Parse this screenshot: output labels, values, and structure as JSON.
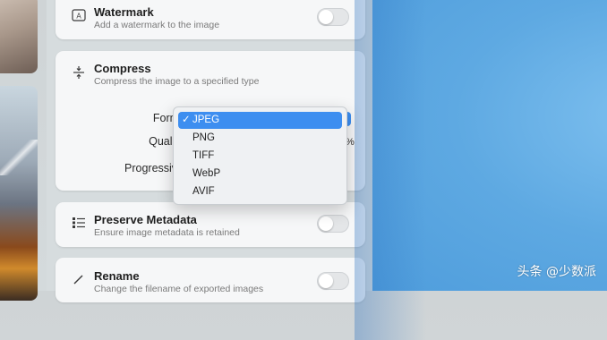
{
  "cards": {
    "watermark": {
      "title": "Watermark",
      "subtitle": "Add a watermark to the image",
      "enabled": false
    },
    "compress": {
      "title": "Compress",
      "subtitle": "Compress the image to a specified type",
      "fields": {
        "format_label": "Forma",
        "quality_label": "Quality",
        "progressive_label": "Progressive"
      },
      "quality_peek": "%"
    },
    "preserve_metadata": {
      "title": "Preserve Metadata",
      "subtitle": "Ensure image metadata is retained",
      "enabled": false
    },
    "rename": {
      "title": "Rename",
      "subtitle": "Change the filename of exported images",
      "enabled": false
    }
  },
  "format_dropdown": {
    "check": "✓",
    "options": [
      "JPEG",
      "PNG",
      "TIFF",
      "WebP",
      "AVIF"
    ],
    "selected": "JPEG"
  },
  "watermark_overlay": "头条 @少数派",
  "colors": {
    "accent": "#3d8ef0",
    "wallpaper": "#5ea9e2"
  }
}
